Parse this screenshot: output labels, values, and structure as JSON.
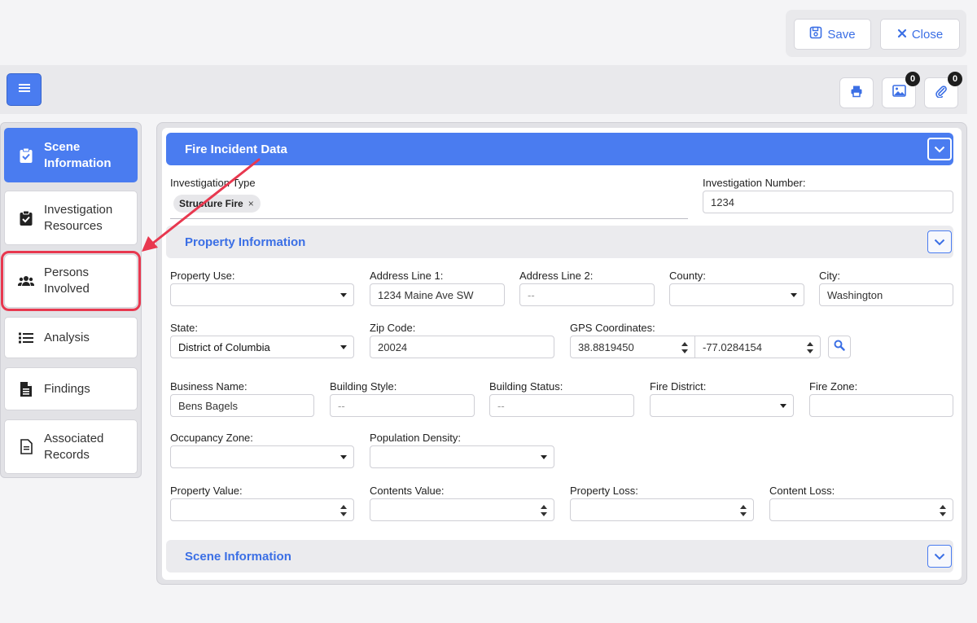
{
  "header": {
    "save_label": "Save",
    "close_label": "Close"
  },
  "toolbar": {
    "gallery_count": "0",
    "attachment_count": "0"
  },
  "sidebar": {
    "items": [
      {
        "label_1": "Scene",
        "label_2": "Information"
      },
      {
        "label_1": "Investigation",
        "label_2": "Resources"
      },
      {
        "label_1": "Persons",
        "label_2": "Involved"
      },
      {
        "label": "Analysis"
      },
      {
        "label": "Findings"
      },
      {
        "label_1": "Associated",
        "label_2": "Records"
      }
    ]
  },
  "fire_incident": {
    "title": "Fire Incident Data",
    "investigation_type_label": "Investigation Type",
    "investigation_type_tag": "Structure Fire",
    "tag_remove": "×",
    "investigation_number_label": "Investigation Number:",
    "investigation_number_value": "1234"
  },
  "property": {
    "title": "Property Information",
    "property_use_label": "Property Use:",
    "address1_label": "Address Line 1:",
    "address1_value": "1234 Maine Ave SW",
    "address2_label": "Address Line 2:",
    "address2_placeholder": "--",
    "county_label": "County:",
    "city_label": "City:",
    "city_value": "Washington",
    "state_label": "State:",
    "state_value": "District of Columbia",
    "zip_label": "Zip Code:",
    "zip_value": "20024",
    "gps_label": "GPS Coordinates:",
    "gps_lat": "38.8819450",
    "gps_lon": "-77.0284154",
    "business_name_label": "Business Name:",
    "business_name_value": "Bens Bagels",
    "building_style_label": "Building Style:",
    "building_style_placeholder": "--",
    "building_status_label": "Building Status:",
    "building_status_placeholder": "--",
    "fire_district_label": "Fire District:",
    "fire_zone_label": "Fire Zone:",
    "occupancy_zone_label": "Occupancy Zone:",
    "population_density_label": "Population Density:",
    "property_value_label": "Property Value:",
    "contents_value_label": "Contents Value:",
    "property_loss_label": "Property Loss:",
    "content_loss_label": "Content Loss:"
  },
  "scene": {
    "title": "Scene Information"
  },
  "colors": {
    "accent": "#4a7cf0",
    "highlight": "#e8384f"
  }
}
